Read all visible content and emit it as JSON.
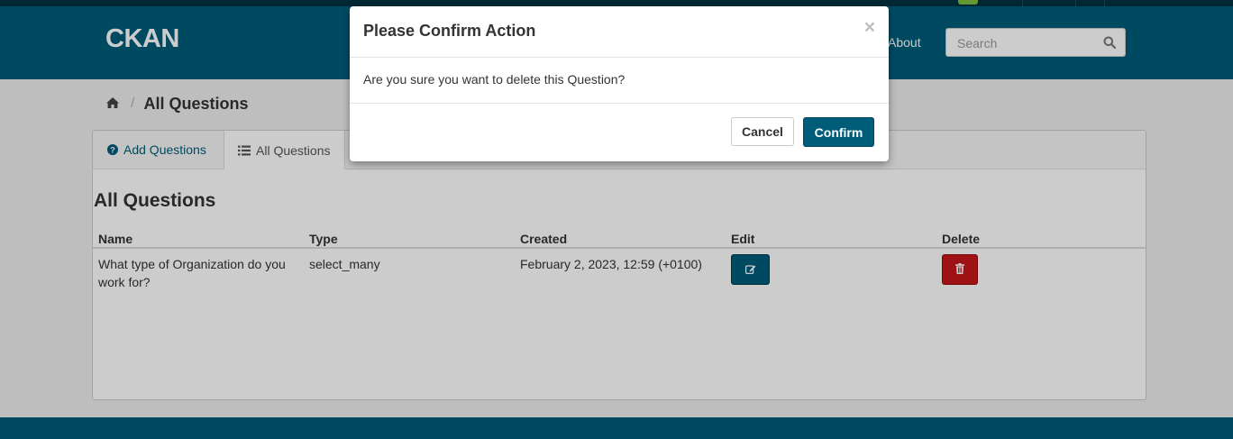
{
  "header": {
    "site_name": "CKAN",
    "nav_about": "About",
    "search_placeholder": "Search",
    "search_icon": "search-icon",
    "brand_color": "#005d7a"
  },
  "breadcrumb": {
    "home_icon": "home-icon",
    "current": "All Questions"
  },
  "tabs": [
    {
      "label": "Add Questions",
      "icon": "question-circle-icon"
    },
    {
      "label": "All Questions",
      "icon": "list-icon",
      "active": true
    }
  ],
  "main": {
    "title": "All Questions",
    "columns": [
      "Name",
      "Type",
      "Created",
      "Edit",
      "Delete"
    ],
    "rows": [
      {
        "name": "What type of Organization do you work for?",
        "type": "select_many",
        "created": "February 2, 2023, 12:59 (+0100)",
        "edit_icon": "edit-icon",
        "delete_icon": "trash-icon"
      }
    ]
  },
  "modal": {
    "title": "Please Confirm Action",
    "close": "×",
    "body": "Are you sure you want to delete this Question?",
    "cancel_label": "Cancel",
    "confirm_label": "Confirm"
  },
  "colors": {
    "danger": "#c6161b",
    "primary": "#005d7a"
  }
}
